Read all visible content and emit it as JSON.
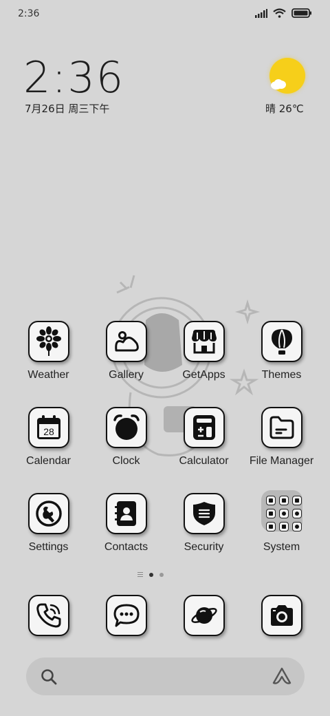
{
  "status_bar": {
    "time": "2:36",
    "icons": [
      "signal-icon",
      "wifi-icon",
      "battery-icon"
    ]
  },
  "clock_widget": {
    "time": "2:36",
    "date": "7月26日 周三下午"
  },
  "weather_widget": {
    "condition_icon": "sun-cloud-icon",
    "text": "晴 26℃",
    "sun_color": "#f6cf1a"
  },
  "apps": [
    {
      "label": "Weather",
      "icon": "weather-flower-icon"
    },
    {
      "label": "Gallery",
      "icon": "gallery-icon"
    },
    {
      "label": "GetApps",
      "icon": "store-icon"
    },
    {
      "label": "Themes",
      "icon": "balloon-icon"
    },
    {
      "label": "Calendar",
      "icon": "calendar-icon",
      "badge": "28"
    },
    {
      "label": "Clock",
      "icon": "clock-icon"
    },
    {
      "label": "Calculator",
      "icon": "calculator-icon"
    },
    {
      "label": "File Manager",
      "icon": "folder-icon"
    },
    {
      "label": "Settings",
      "icon": "settings-icon"
    },
    {
      "label": "Contacts",
      "icon": "contacts-icon"
    },
    {
      "label": "Security",
      "icon": "shield-icon"
    },
    {
      "label": "System",
      "icon": "folder-grid-icon"
    }
  ],
  "page_indicator": {
    "pages": 2,
    "active": 1
  },
  "dock": [
    {
      "name": "Phone",
      "icon": "phone-icon"
    },
    {
      "name": "Messaging",
      "icon": "chat-icon"
    },
    {
      "name": "Browser",
      "icon": "planet-icon"
    },
    {
      "name": "Camera",
      "icon": "camera-icon"
    }
  ],
  "search": {
    "placeholder": "",
    "left_icon": "search-icon",
    "right_icon": "assistant-icon"
  },
  "colors": {
    "background": "#d6d6d6",
    "tile": "#f5f5f5",
    "outline": "#111111"
  }
}
